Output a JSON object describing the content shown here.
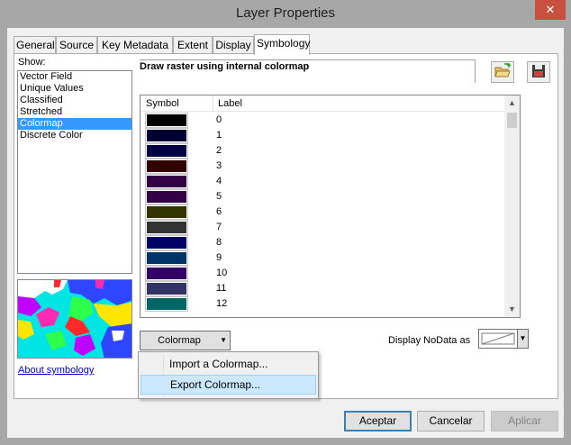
{
  "window": {
    "title": "Layer Properties",
    "close_glyph": "✕"
  },
  "tabs": [
    {
      "label": "General"
    },
    {
      "label": "Source"
    },
    {
      "label": "Key Metadata"
    },
    {
      "label": "Extent"
    },
    {
      "label": "Display"
    },
    {
      "label": "Symbology"
    }
  ],
  "active_tab": "Symbology",
  "symbology": {
    "show_label": "Show:",
    "show_items": [
      {
        "label": "Vector Field"
      },
      {
        "label": "Unique Values"
      },
      {
        "label": "Classified"
      },
      {
        "label": "Stretched"
      },
      {
        "label": "Colormap"
      },
      {
        "label": "Discrete Color"
      }
    ],
    "selected_show_item": "Colormap",
    "heading": "Draw raster using internal colormap",
    "about_link": "About symbology",
    "toolbar_icons": [
      "open-folder-icon",
      "save-icon"
    ],
    "table": {
      "col_symbol": "Symbol",
      "col_label": "Label",
      "rows": [
        {
          "label": "0",
          "color": "#000000"
        },
        {
          "label": "1",
          "color": "#000033"
        },
        {
          "label": "2",
          "color": "#000045"
        },
        {
          "label": "3",
          "color": "#330000"
        },
        {
          "label": "4",
          "color": "#330045"
        },
        {
          "label": "5",
          "color": "#330045"
        },
        {
          "label": "6",
          "color": "#333300"
        },
        {
          "label": "7",
          "color": "#333333"
        },
        {
          "label": "8",
          "color": "#000066"
        },
        {
          "label": "9",
          "color": "#003366"
        },
        {
          "label": "10",
          "color": "#330066"
        },
        {
          "label": "11",
          "color": "#333366"
        },
        {
          "label": "12",
          "color": "#006666"
        }
      ]
    },
    "colormap_button": "Colormap",
    "nodata_label": "Display NoData as",
    "popup_menu": [
      {
        "label": "Import a Colormap..."
      },
      {
        "label": "Export Colormap..."
      }
    ],
    "highlighted_menu_item": "Export Colormap..."
  },
  "footer": {
    "ok": "Aceptar",
    "cancel": "Cancelar",
    "apply": "Aplicar"
  }
}
